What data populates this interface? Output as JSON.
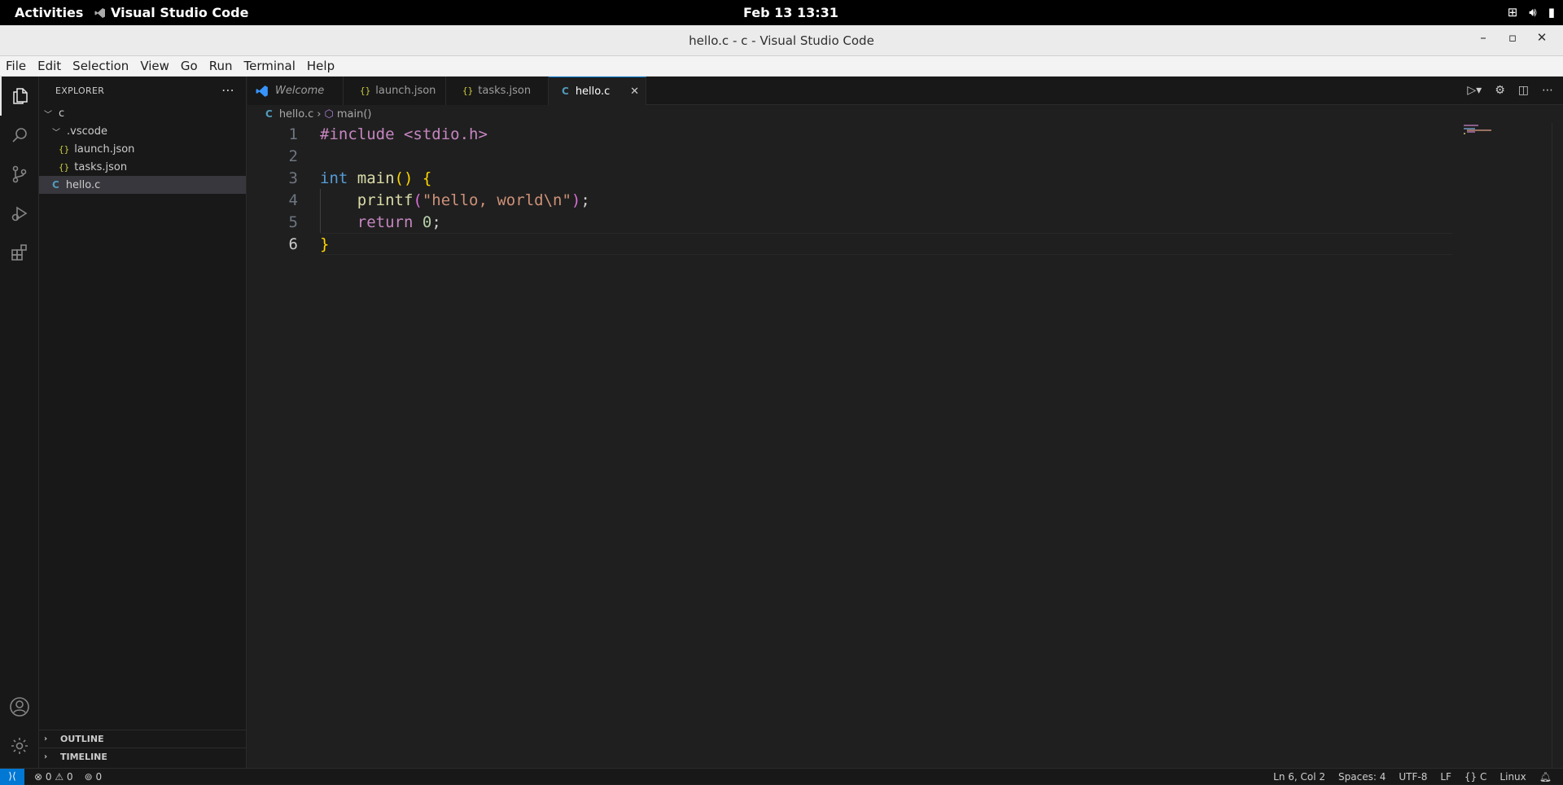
{
  "system": {
    "activities": "Activities",
    "app_name": "Visual Studio Code",
    "clock": "Feb 13  13:31"
  },
  "window": {
    "title": "hello.c - c - Visual Studio Code"
  },
  "menu": [
    "File",
    "Edit",
    "Selection",
    "View",
    "Go",
    "Run",
    "Terminal",
    "Help"
  ],
  "sidebar": {
    "header": "EXPLORER",
    "tree": {
      "root": "c",
      "folder": ".vscode",
      "files_in_folder": [
        "launch.json",
        "tasks.json"
      ],
      "root_file": "hello.c"
    },
    "sections": [
      "OUTLINE",
      "TIMELINE"
    ]
  },
  "tabs": [
    {
      "label": "Welcome",
      "icon": "vscode-logo-icon"
    },
    {
      "label": "launch.json",
      "icon": "json-icon"
    },
    {
      "label": "tasks.json",
      "icon": "json-icon"
    },
    {
      "label": "hello.c",
      "icon": "c-file-icon",
      "active": true
    }
  ],
  "breadcrumb": {
    "file": "hello.c",
    "symbol": "main()"
  },
  "editor": {
    "line_numbers": [
      "1",
      "2",
      "3",
      "4",
      "5",
      "6"
    ],
    "current_line": 6,
    "lines": [
      [
        {
          "t": "#include <stdio.h>",
          "c": "pp"
        }
      ],
      [],
      [
        {
          "t": "int",
          "c": "type"
        },
        {
          "t": " ",
          "c": ""
        },
        {
          "t": "main",
          "c": "fn"
        },
        {
          "t": "()",
          "c": "br1"
        },
        {
          "t": " ",
          "c": ""
        },
        {
          "t": "{",
          "c": "br1"
        }
      ],
      [
        {
          "t": "    ",
          "c": ""
        },
        {
          "t": "printf",
          "c": "fn"
        },
        {
          "t": "(",
          "c": "br2"
        },
        {
          "t": "\"hello, world\\n\"",
          "c": "str"
        },
        {
          "t": ")",
          "c": "br2"
        },
        {
          "t": ";",
          "c": ""
        }
      ],
      [
        {
          "t": "    ",
          "c": ""
        },
        {
          "t": "return",
          "c": "pp"
        },
        {
          "t": " ",
          "c": ""
        },
        {
          "t": "0",
          "c": "num"
        },
        {
          "t": ";",
          "c": ""
        }
      ],
      [
        {
          "t": "}",
          "c": "br1"
        }
      ]
    ]
  },
  "status": {
    "errors": "0",
    "warnings": "0",
    "ports": "0",
    "position": "Ln 6, Col 2",
    "spaces": "Spaces: 4",
    "encoding": "UTF-8",
    "eol": "LF",
    "language": "C",
    "platform": "Linux"
  },
  "colors": {
    "accent": "#0078d4",
    "preprocessor": "#c586c0",
    "string": "#ce9178",
    "keyword_type": "#569cd6",
    "function": "#dcdcaa"
  }
}
